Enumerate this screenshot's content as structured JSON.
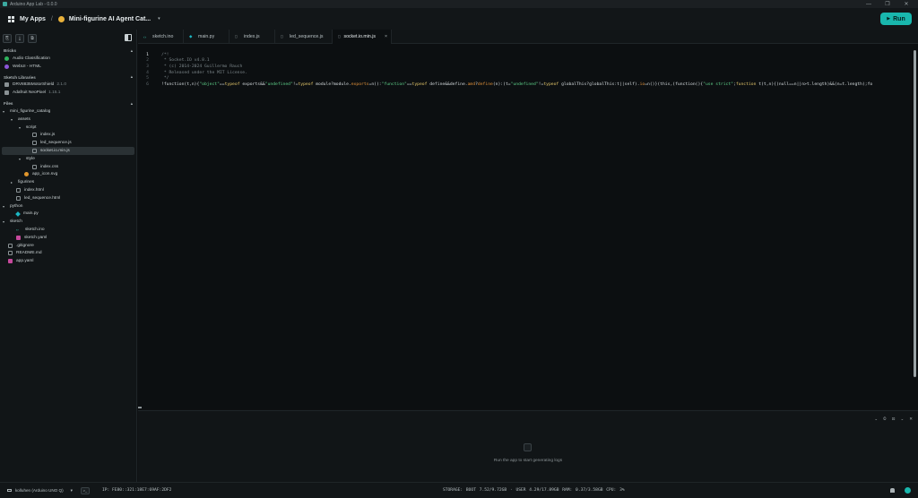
{
  "window": {
    "title": "Arduino App Lab - 0.0.0",
    "controls": [
      "—",
      "❐",
      "✕"
    ]
  },
  "header": {
    "my_apps": "My Apps",
    "separator": "/",
    "app_name": "Mini-figurine AI Agent Cat...",
    "chevron": "▾",
    "run_label": "Run",
    "run_icon": "▶"
  },
  "sidebar": {
    "toolbar": [
      "⎘",
      "⤓",
      "⧉"
    ],
    "bricks_title": "Bricks",
    "bricks": [
      {
        "label": "Audio Classification",
        "icon": "green-dot"
      },
      {
        "label": "WebUI - HTML",
        "icon": "purple-dot"
      }
    ],
    "libraries_title": "Sketch Libraries",
    "libraries": [
      {
        "label": "DRV8835MotorShield",
        "version": "2.1.0"
      },
      {
        "label": "Adafruit NeoPixel",
        "version": "1.15.1"
      }
    ],
    "files_title": "Files",
    "collapse_caret": "▴",
    "tree": [
      {
        "label": "mini_figurine_catalog",
        "depth": 0,
        "type": "folder-open"
      },
      {
        "label": "assets",
        "depth": 1,
        "type": "folder-open"
      },
      {
        "label": "script",
        "depth": 2,
        "type": "folder-open"
      },
      {
        "label": "index.js",
        "depth": 3,
        "type": "file"
      },
      {
        "label": "led_sequence.js",
        "depth": 3,
        "type": "file"
      },
      {
        "label": "socket.io.min.js",
        "depth": 3,
        "type": "file",
        "selected": true
      },
      {
        "label": "style",
        "depth": 2,
        "type": "folder-open"
      },
      {
        "label": "index.css",
        "depth": 3,
        "type": "file"
      },
      {
        "label": "app_icon.svg",
        "depth": 2,
        "type": "svg"
      },
      {
        "label": "figurines",
        "depth": 1,
        "type": "folder-closed"
      },
      {
        "label": "index.html",
        "depth": 1,
        "type": "file"
      },
      {
        "label": "led_sequence.html",
        "depth": 1,
        "type": "file"
      },
      {
        "label": "python",
        "depth": 0,
        "type": "folder-open"
      },
      {
        "label": "main.py",
        "depth": 1,
        "type": "py"
      },
      {
        "label": "sketch",
        "depth": 0,
        "type": "folder-open"
      },
      {
        "label": "sketch.ino",
        "depth": 1,
        "type": "ino"
      },
      {
        "label": "sketch.yaml",
        "depth": 1,
        "type": "yaml"
      },
      {
        "label": ".gitignore",
        "depth": 0,
        "type": "file"
      },
      {
        "label": "README.md",
        "depth": 0,
        "type": "file"
      },
      {
        "label": "app.yaml",
        "depth": 0,
        "type": "yaml"
      }
    ]
  },
  "tabs": [
    {
      "label": "sketch.ino",
      "icon": "‹›"
    },
    {
      "label": "main.py",
      "icon": "◆"
    },
    {
      "label": "index.js",
      "icon": "▯"
    },
    {
      "label": "led_sequence.js",
      "icon": "▯"
    },
    {
      "label": "socket.io.min.js",
      "icon": "▯",
      "active": true,
      "close": "×"
    }
  ],
  "code_lines": [
    {
      "n": "1",
      "parts": [
        {
          "t": "/*!",
          "c": "comment"
        }
      ]
    },
    {
      "n": "2",
      "parts": [
        {
          "t": " * Socket.IO v4.8.1",
          "c": "comment"
        }
      ]
    },
    {
      "n": "3",
      "parts": [
        {
          "t": " * (c) 2014-2024 Guillermo Rauch",
          "c": "comment"
        }
      ]
    },
    {
      "n": "4",
      "parts": [
        {
          "t": " * Released under the MIT License.",
          "c": "comment"
        }
      ]
    },
    {
      "n": "5",
      "parts": [
        {
          "t": " */",
          "c": "comment"
        }
      ]
    },
    {
      "n": "6",
      "parts": [
        {
          "t": "!function(t,n){",
          "c": "code"
        },
        {
          "t": "\"object\"",
          "c": "str"
        },
        {
          "t": "==",
          "c": "code"
        },
        {
          "t": "typeof",
          "c": "kw"
        },
        {
          "t": " exports&&",
          "c": "code"
        },
        {
          "t": "\"undefined\"",
          "c": "str"
        },
        {
          "t": "!=",
          "c": "code"
        },
        {
          "t": "typeof",
          "c": "kw"
        },
        {
          "t": " module?module.",
          "c": "code"
        },
        {
          "t": "exports",
          "c": "fn"
        },
        {
          "t": "=n():",
          "c": "code"
        },
        {
          "t": "\"function\"",
          "c": "str"
        },
        {
          "t": "==",
          "c": "code"
        },
        {
          "t": "typeof",
          "c": "kw"
        },
        {
          "t": " define&&define.",
          "c": "code"
        },
        {
          "t": "amd",
          "c": "fn"
        },
        {
          "t": "?",
          "c": "code"
        },
        {
          "t": "define",
          "c": "fn"
        },
        {
          "t": "(n):(t=",
          "c": "code"
        },
        {
          "t": "\"undefined\"",
          "c": "str"
        },
        {
          "t": "!=",
          "c": "code"
        },
        {
          "t": "typeof",
          "c": "kw"
        },
        {
          "t": " globalThis?globalThis:t||self).",
          "c": "code"
        },
        {
          "t": "io",
          "c": "fn"
        },
        {
          "t": "=n()}(this,(function(){",
          "c": "code"
        },
        {
          "t": "\"use strict\"",
          "c": "str"
        },
        {
          "t": ";",
          "c": "code"
        },
        {
          "t": "function",
          "c": "kw"
        },
        {
          "t": " t(t,n){(null==n||n>t.length)&&(n=t.length);fo",
          "c": "code"
        }
      ]
    }
  ],
  "logs": {
    "empty_message": "Run the app to start generating logs",
    "controls": [
      "⌄",
      "⏲",
      "⊡",
      "⌄",
      "✕"
    ]
  },
  "status": {
    "board": "kolluhen (Arduino UNO Q)",
    "board_chevron": "▾",
    "terminal_icon": ">_",
    "ip": "IP: FE80::321:18E7:69AF:2DF2",
    "metrics": "STORAGE: BOOT 7.52/9.72GB · USER 4.29/17.89GB   RAM: 0.37/3.58GB   CPU: 3%"
  }
}
